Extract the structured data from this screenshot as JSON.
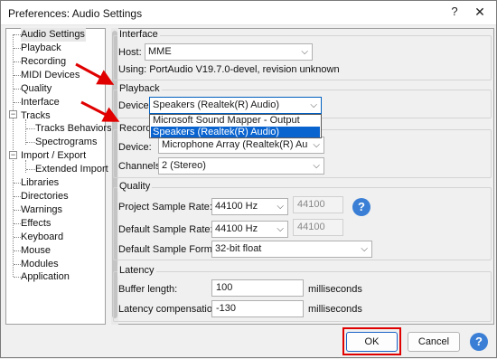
{
  "window": {
    "title": "Preferences: Audio Settings",
    "help_glyph": "?",
    "close_glyph": "✕"
  },
  "tree": {
    "items": [
      {
        "label": "Audio Settings",
        "selected": true
      },
      {
        "label": "Playback"
      },
      {
        "label": "Recording"
      },
      {
        "label": "MIDI Devices"
      },
      {
        "label": "Quality"
      },
      {
        "label": "Interface"
      },
      {
        "label": "Tracks"
      },
      {
        "label": "Tracks Behaviors"
      },
      {
        "label": "Spectrograms"
      },
      {
        "label": "Import / Export"
      },
      {
        "label": "Extended Import"
      },
      {
        "label": "Libraries"
      },
      {
        "label": "Directories"
      },
      {
        "label": "Warnings"
      },
      {
        "label": "Effects"
      },
      {
        "label": "Keyboard"
      },
      {
        "label": "Mouse"
      },
      {
        "label": "Modules"
      },
      {
        "label": "Application"
      }
    ],
    "expander_glyph": "−"
  },
  "interface": {
    "heading": "Interface",
    "host_label": "Host:",
    "host_value": "MME",
    "using_text": "Using: PortAudio V19.7.0-devel, revision unknown"
  },
  "playback": {
    "heading": "Playback",
    "device_label": "Device:",
    "device_value": "Speakers (Realtek(R) Audio)",
    "dropdown_options": [
      "Microsoft Sound Mapper - Output",
      "Speakers (Realtek(R) Audio)"
    ],
    "selected_option_index": 1
  },
  "recording": {
    "heading": "Recording",
    "device_label": "Device:",
    "device_value": "Microphone Array (Realtek(R) Au",
    "channels_label": "Channels:",
    "channels_value": "2 (Stereo)"
  },
  "quality": {
    "heading": "Quality",
    "project_rate_label": "Project Sample Rate:",
    "project_rate_value": "44100 Hz",
    "project_rate_custom": "44100",
    "default_rate_label": "Default Sample Rate:",
    "default_rate_value": "44100 Hz",
    "default_rate_custom": "44100",
    "format_label": "Default Sample Format:",
    "format_value": "32-bit float",
    "help_glyph": "?"
  },
  "latency": {
    "heading": "Latency",
    "buffer_label": "Buffer length:",
    "buffer_value": "100",
    "buffer_unit": "milliseconds",
    "comp_label": "Latency compensation:",
    "comp_value": "-130",
    "comp_unit": "milliseconds"
  },
  "footer": {
    "ok_label": "OK",
    "cancel_label": "Cancel",
    "help_glyph": "?"
  },
  "colors": {
    "annotation_red": "#e00000",
    "selection_blue": "#0a64d0",
    "help_blue": "#3a7fd5"
  },
  "combo_arrow_glyph": "⌵"
}
